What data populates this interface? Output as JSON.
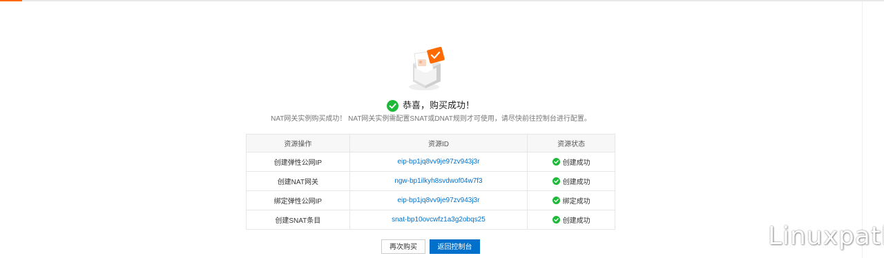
{
  "success": {
    "title": "恭喜，购买成功！",
    "description": "NAT网关实例购买成功！ NAT网关实例需配置SNAT或DNAT规则才可使用，请尽快前往控制台进行配置。",
    "check_icon": "check-circle-icon",
    "illustration_icon": "order-success-illustration"
  },
  "table": {
    "headers": [
      "资源操作",
      "资源ID",
      "资源状态"
    ],
    "rows": [
      {
        "operation": "创建弹性公网IP",
        "resource_id": "eip-bp1jq8vv9je97zv943j3r",
        "status": "创建成功"
      },
      {
        "operation": "创建NAT网关",
        "resource_id": "ngw-bp1ilkyh8svdwof04w7f3",
        "status": "创建成功"
      },
      {
        "operation": "绑定弹性公网IP",
        "resource_id": "eip-bp1jq8vv9je97zv943j3r",
        "status": "绑定成功"
      },
      {
        "operation": "创建SNAT条目",
        "resource_id": "snat-bp10ovcwfz1a3g2obqs25",
        "status": "创建成功"
      }
    ]
  },
  "buttons": {
    "buy_again": "再次购买",
    "back_to_console": "返回控制台"
  },
  "watermark": "Linuxpath",
  "colors": {
    "brand_orange": "#ff6a00",
    "link_blue": "#0070cc",
    "primary_button": "#0070cc",
    "success_green": "#1fb93a"
  }
}
